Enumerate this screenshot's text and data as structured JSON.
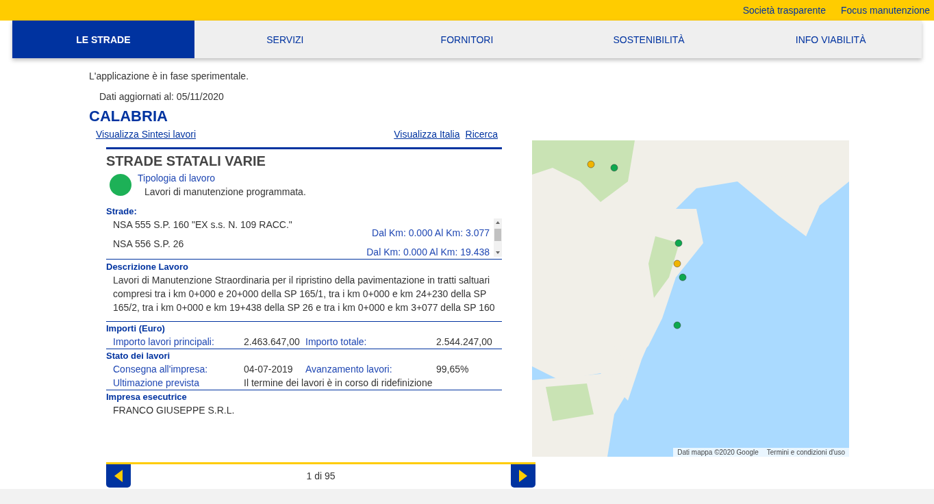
{
  "top_links": [
    "Società trasparente",
    "Focus manutenzione"
  ],
  "nav": [
    {
      "label": "LE STRADE",
      "selected": true
    },
    {
      "label": "SERVIZI",
      "selected": false
    },
    {
      "label": "FORNITORI",
      "selected": false
    },
    {
      "label": "SOSTENIBILITÀ",
      "selected": false
    },
    {
      "label": "INFO VIABILITÀ",
      "selected": false
    }
  ],
  "notice": "L'applicazione è in fase sperimentale.",
  "updated": "Dati aggiornati al: 05/11/2020",
  "region": "CALABRIA",
  "links_left": [
    "Visualizza Sintesi lavori"
  ],
  "links_right": [
    "Visualizza Italia",
    "Ricerca"
  ],
  "work": {
    "title": "STRADE STATALI VARIE",
    "type": {
      "label": "Tipologia di lavoro",
      "value": "Lavori di manutenzione programmata.",
      "color": "#1db157"
    },
    "roads_heading": "Strade:",
    "roads": [
      {
        "name": "NSA 555 S.P. 160 \"EX s.s. N. 109 RACC.\"",
        "km": "Dal Km: 0.000 Al Km: 3.077"
      },
      {
        "name": "NSA 556 S.P. 26",
        "km": "Dal Km: 0.000 Al Km: 19.438"
      }
    ],
    "description_heading": "Descrizione Lavoro",
    "description": "Lavori di Manutenzione Straordinaria per il ripristino della pavimentazione in tratti saltuari compresi tra i km 0+000 e 20+000 della SP 165/1, tra i km 0+000 e km 24+230 della SP 165/2, tra i km 0+000 e km 19+438 della SP 26 e tra i km 0+000 e km 3+077 della SP 160",
    "sections": [
      {
        "heading": "Importi (Euro)",
        "rows": [
          {
            "kind": "pair",
            "label": "Importo lavori principali:",
            "value": "2.463.647,00",
            "label2": "Importo totale:",
            "value2": "2.544.247,00"
          }
        ]
      },
      {
        "heading": "Stato dei lavori",
        "rows": [
          {
            "kind": "pair",
            "label": "Consegna all'impresa:",
            "value": "04-07-2019",
            "label2": "Avanzamento lavori:",
            "value2": "99,65%"
          },
          {
            "kind": "wide",
            "label": "Ultimazione prevista",
            "value": "Il termine dei lavori è in corso di ridefinizione"
          }
        ]
      },
      {
        "heading": "Impresa esecutrice",
        "rows": [
          {
            "kind": "plain",
            "value": "FRANCO GIUSEPPE S.R.L."
          }
        ]
      }
    ]
  },
  "pager": {
    "label": "1 di 95"
  },
  "map": {
    "kind": "picture",
    "attribution": [
      "Dati mappa ©2020 Google",
      "Termini e condizioni d'uso"
    ]
  }
}
